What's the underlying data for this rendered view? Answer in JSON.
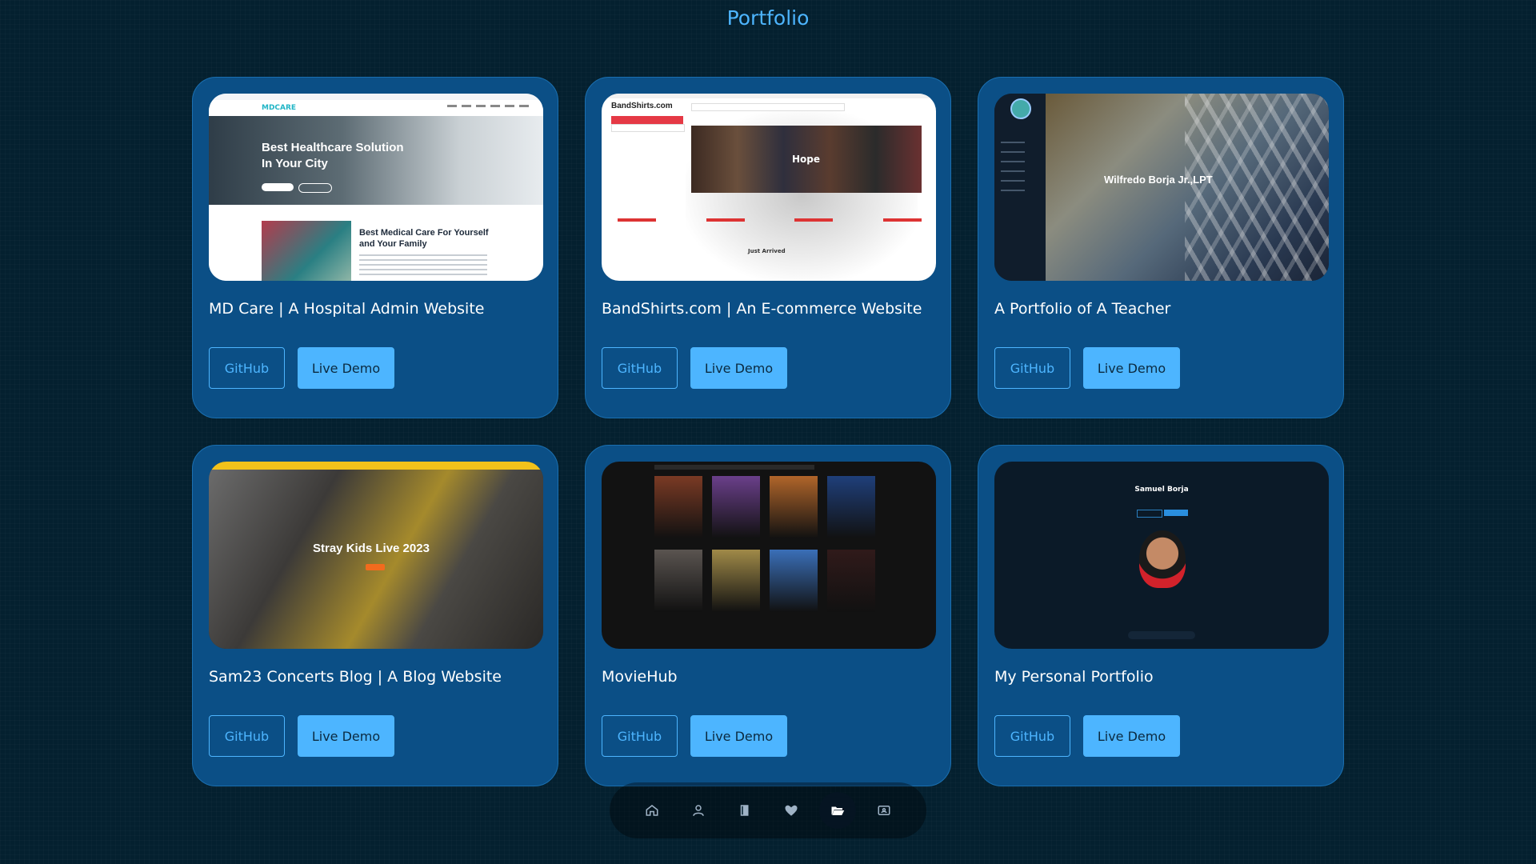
{
  "section": {
    "title": "Portfolio"
  },
  "projects": [
    {
      "title": "MD Care | A Hospital Admin Website",
      "github_label": "GitHub",
      "demo_label": "Live Demo",
      "thumb": {
        "logo": "MDCARE",
        "headline_1": "Best Healthcare Solution",
        "headline_2": "In Your City",
        "sub_1": "Best Medical Care For Yourself",
        "sub_2": "and Your Family"
      }
    },
    {
      "title": "BandShirts.com | An E-commerce Website",
      "github_label": "GitHub",
      "demo_label": "Live Demo",
      "thumb": {
        "brand": "BandShirts.com",
        "hero": "Hope",
        "section": "Just Arrived"
      }
    },
    {
      "title": "A Portfolio of A Teacher",
      "github_label": "GitHub",
      "demo_label": "Live Demo",
      "thumb": {
        "name": "Wilfredo Borja Jr.,LPT"
      }
    },
    {
      "title": "Sam23 Concerts Blog | A Blog Website",
      "github_label": "GitHub",
      "demo_label": "Live Demo",
      "thumb": {
        "hero": "Stray Kids Live 2023"
      }
    },
    {
      "title": "MovieHub",
      "github_label": "GitHub",
      "demo_label": "Live Demo",
      "thumb": {
        "poster_colors": [
          "#7a3a24",
          "#6a3f8a",
          "#b0652a",
          "#1f3f7a",
          "#5a5450",
          "#a08a48",
          "#3a6fb8",
          "#301a1a"
        ]
      }
    },
    {
      "title": "My Personal Portfolio",
      "github_label": "GitHub",
      "demo_label": "Live Demo",
      "thumb": {
        "name": "Samuel Borja"
      }
    }
  ],
  "bottom_nav": {
    "items": [
      {
        "icon": "home-icon",
        "active": false
      },
      {
        "icon": "user-icon",
        "active": false
      },
      {
        "icon": "book-icon",
        "active": false
      },
      {
        "icon": "handshake-icon",
        "active": false
      },
      {
        "icon": "folder-open-icon",
        "active": true
      },
      {
        "icon": "contact-card-icon",
        "active": false
      }
    ]
  },
  "colors": {
    "background": "#04202f",
    "card": "#0b4f86",
    "accent": "#4db5ff"
  }
}
